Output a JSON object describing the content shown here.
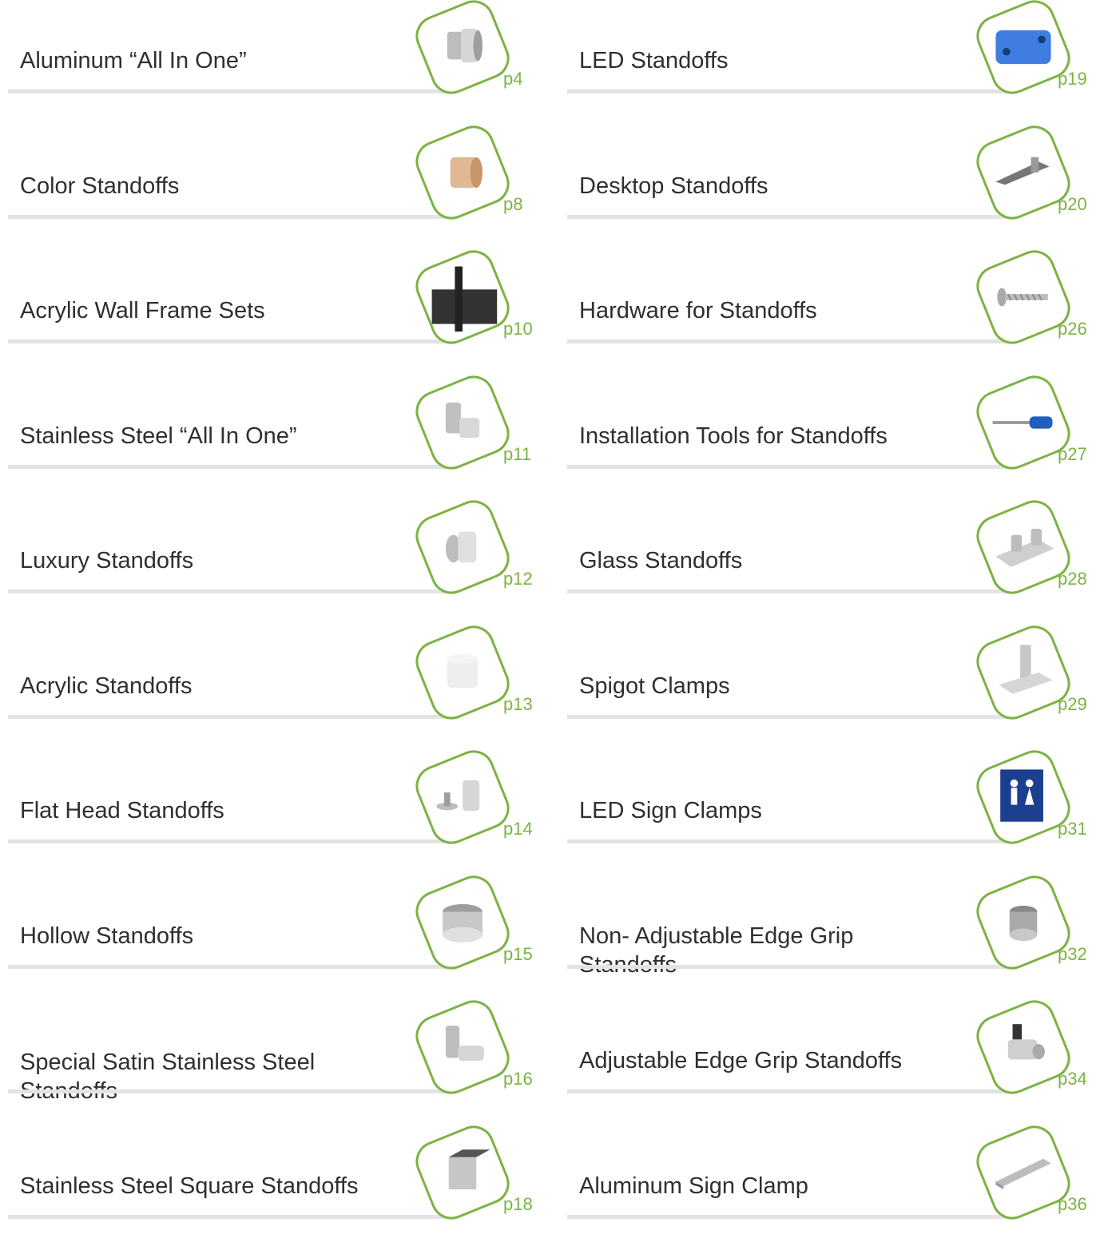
{
  "left": [
    {
      "title": "Aluminum “All In One”",
      "page": "p4",
      "icon": "standoff-aluminum-icon"
    },
    {
      "title": "Color Standoffs",
      "page": "p8",
      "icon": "standoff-color-icon"
    },
    {
      "title": "Acrylic Wall Frame Sets",
      "page": "p10",
      "icon": "wall-frame-icon"
    },
    {
      "title": "Stainless Steel “All In One”",
      "page": "p11",
      "icon": "standoff-stainless-icon"
    },
    {
      "title": "Luxury Standoffs",
      "page": "p12",
      "icon": "standoff-luxury-icon"
    },
    {
      "title": "Acrylic Standoffs",
      "page": "p13",
      "icon": "standoff-acrylic-icon"
    },
    {
      "title": "Flat Head Standoffs",
      "page": "p14",
      "icon": "standoff-flathead-icon"
    },
    {
      "title": "Hollow Standoffs",
      "page": "p15",
      "icon": "standoff-hollow-icon"
    },
    {
      "title": "Special Satin Stainless Steel Standoffs",
      "page": "p16",
      "icon": "standoff-satin-icon"
    },
    {
      "title": "Stainless Steel Square Standoffs",
      "page": "p18",
      "icon": "standoff-square-icon"
    }
  ],
  "right": [
    {
      "title": "LED Standoffs",
      "page": "p19",
      "icon": "led-standoff-icon"
    },
    {
      "title": "Desktop Standoffs",
      "page": "p20",
      "icon": "desktop-standoff-icon"
    },
    {
      "title": "Hardware for Standoffs",
      "page": "p26",
      "icon": "screw-icon"
    },
    {
      "title": "Installation Tools for Standoffs",
      "page": "p27",
      "icon": "screwdriver-icon"
    },
    {
      "title": "Glass Standoffs",
      "page": "p28",
      "icon": "glass-standoff-icon"
    },
    {
      "title": "Spigot Clamps",
      "page": "p29",
      "icon": "spigot-clamp-icon"
    },
    {
      "title": "LED Sign Clamps",
      "page": "p31",
      "icon": "led-sign-icon"
    },
    {
      "title": "Non- Adjustable Edge Grip Standoffs",
      "page": "p32",
      "icon": "edge-grip-icon"
    },
    {
      "title": "Adjustable Edge Grip Standoffs",
      "page": "p34",
      "icon": "adjustable-edge-grip-icon"
    },
    {
      "title": "Aluminum Sign Clamp",
      "page": "p36",
      "icon": "sign-clamp-icon"
    }
  ],
  "colors": {
    "accent": "#7cb342",
    "rule": "#e3e3e3",
    "text": "#2f2f2f"
  }
}
